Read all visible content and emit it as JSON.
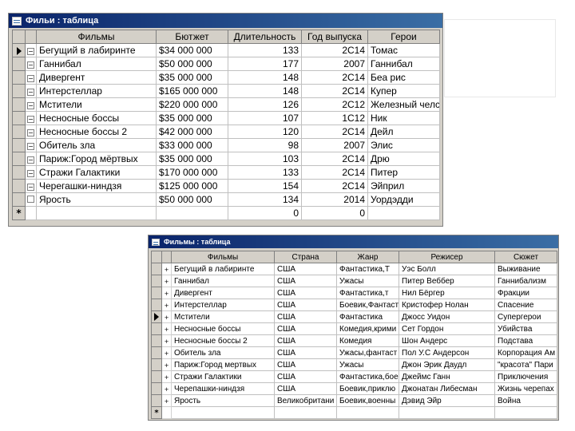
{
  "table1": {
    "title": "Фильи : таблица",
    "headers": [
      "Фильмы",
      "Бютжет",
      "Длительность",
      "Год выпуска",
      "Герои"
    ],
    "rows": [
      {
        "film": "Бегущий в лабиринте",
        "budget": "$34 000 000",
        "duration": "133",
        "year": "2С14",
        "hero": "Томас"
      },
      {
        "film": "Ганнибал",
        "budget": "$50 000 000",
        "duration": "177",
        "year": "2007",
        "hero": "Ганнибал"
      },
      {
        "film": "Дивергент",
        "budget": "$35 000 000",
        "duration": "148",
        "year": "2С14",
        "hero": "Беа рис"
      },
      {
        "film": "Интерстеллар",
        "budget": "$165 000 000",
        "duration": "148",
        "year": "2С14",
        "hero": "Купер"
      },
      {
        "film": "Мстители",
        "budget": "$220 000 000",
        "duration": "126",
        "year": "2С12",
        "hero": "Железный челс"
      },
      {
        "film": "Несносные боссы",
        "budget": "$35 000 000",
        "duration": "107",
        "year": "1С12",
        "hero": "Ник"
      },
      {
        "film": "Несносные боссы 2",
        "budget": "$42 000 000",
        "duration": "120",
        "year": "2С14",
        "hero": "Дейл"
      },
      {
        "film": "Обитель зла",
        "budget": "$33 000 000",
        "duration": "98",
        "year": "2007",
        "hero": "Элис"
      },
      {
        "film": "Париж:Город мёртвых",
        "budget": "$35 000 000",
        "duration": "103",
        "year": "2С14",
        "hero": "Дрю"
      },
      {
        "film": "Стражи Галактики",
        "budget": "$170 000 000",
        "duration": "133",
        "year": "2С14",
        "hero": "Питер"
      },
      {
        "film": "Черегашки-ниндзя",
        "budget": "$125 000 000",
        "duration": "154",
        "year": "2С14",
        "hero": "Эйприл"
      },
      {
        "film": "Ярость",
        "budget": "$50 000 000",
        "duration": "134",
        "year": "2014",
        "hero": "Уордэдди"
      }
    ],
    "new_row": {
      "duration": "0",
      "year": "0"
    }
  },
  "table2": {
    "title": "Фильмы : таблица",
    "headers": [
      "Фильмы",
      "Страна",
      "Жанр",
      "Режисер",
      "Сюжет"
    ],
    "rows": [
      {
        "film": "Бегущий в лабиринте",
        "country": "США",
        "genre": "Фантастика,Т",
        "director": "Уэс Болл",
        "plot": "Выживание"
      },
      {
        "film": "Ганнибал",
        "country": "США",
        "genre": "Ужасы",
        "director": "Питер Веббер",
        "plot": "Ганнибализм"
      },
      {
        "film": "Дивергент",
        "country": "США",
        "genre": "Фантастика,т",
        "director": "Нил Бёргер",
        "plot": "Фракции"
      },
      {
        "film": "Интерстеллар",
        "country": "США",
        "genre": "Боевик,Фантаст",
        "director": "Кристофер Нолан",
        "plot": "Спасение"
      },
      {
        "film": "Мстители",
        "country": "США",
        "genre": "Фантастика",
        "director": "Джосс Уидон",
        "plot": "Супергерои"
      },
      {
        "film": "Несносные боссы",
        "country": "США",
        "genre": "Комедия,крими",
        "director": "Сет Гордон",
        "plot": "Убийства"
      },
      {
        "film": "Несносные боссы 2",
        "country": "США",
        "genre": "Комедия",
        "director": "Шон Андерс",
        "plot": "Подстава"
      },
      {
        "film": "Обитель зла",
        "country": "США",
        "genre": "Ужасы,фантаст",
        "director": "Пол У.С Андерсон",
        "plot": "Корпорация Ам"
      },
      {
        "film": "Париж:Город мертвых",
        "country": "США",
        "genre": "Ужасы",
        "director": "Джон Эрик Даудл",
        "plot": "\"красота\" Пари"
      },
      {
        "film": "Стражи Галактики",
        "country": "США",
        "genre": "Фантастика,бое",
        "director": "Джеймс Ганн",
        "plot": "Приключения"
      },
      {
        "film": "Черепашки-ниндзя",
        "country": "США",
        "genre": "Боевик,приклю",
        "director": "Джонатан Либесман",
        "plot": "Жизнь черепах"
      },
      {
        "film": "Ярость",
        "country": "Великобритани",
        "genre": "Боевик,военны",
        "director": "Дэвид Эйр",
        "plot": "Война"
      }
    ]
  },
  "symbols": {
    "expand": "+",
    "new_row": "*"
  }
}
